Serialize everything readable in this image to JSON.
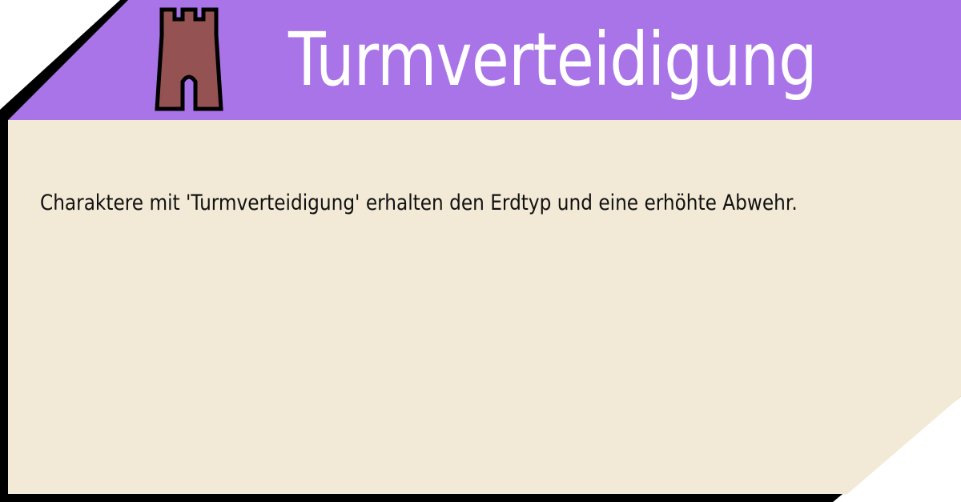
{
  "card": {
    "title": "Turmverteidigung",
    "description": "Charaktere mit 'Turmverteidigung' erhalten den Erdtyp und eine erhöhte Abwehr.",
    "icon": "tower-icon"
  },
  "colors": {
    "header": "#a974e7",
    "body": "#f2ead6",
    "border": "#000000",
    "tower_fill": "#955252",
    "title_text": "#ffffff",
    "body_text": "#111111"
  }
}
